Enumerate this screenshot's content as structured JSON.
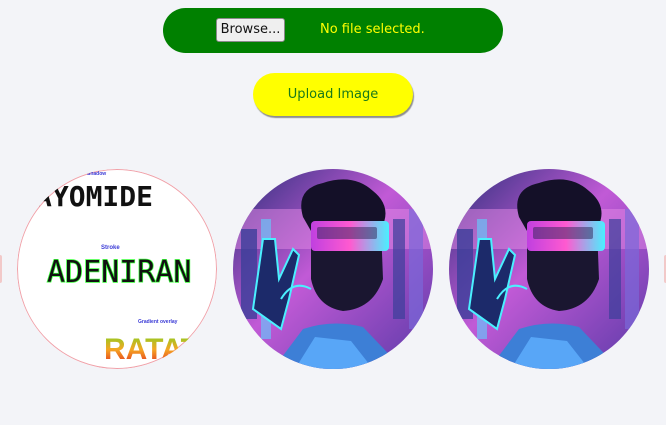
{
  "upload_form": {
    "browse_label": "Browse...",
    "file_status": "No file selected.",
    "upload_label": "Upload Image"
  },
  "gallery": [
    {
      "kind": "text-effects-sample",
      "labels": {
        "shadow": "Shadow",
        "name1": "AYOMIDE",
        "stroke": "Stroke",
        "name2": "ADENIRAN",
        "gradient": "Gradient overlay",
        "name3": "RATATI"
      }
    },
    {
      "kind": "cyberpunk-vr-portrait"
    },
    {
      "kind": "cyberpunk-vr-portrait"
    }
  ],
  "colors": {
    "file_bar": "#008000",
    "file_status_text": "#ffff00",
    "upload_button": "#ffff00",
    "upload_text": "#1a7a1a",
    "page_bg": "#f3f4f8"
  }
}
